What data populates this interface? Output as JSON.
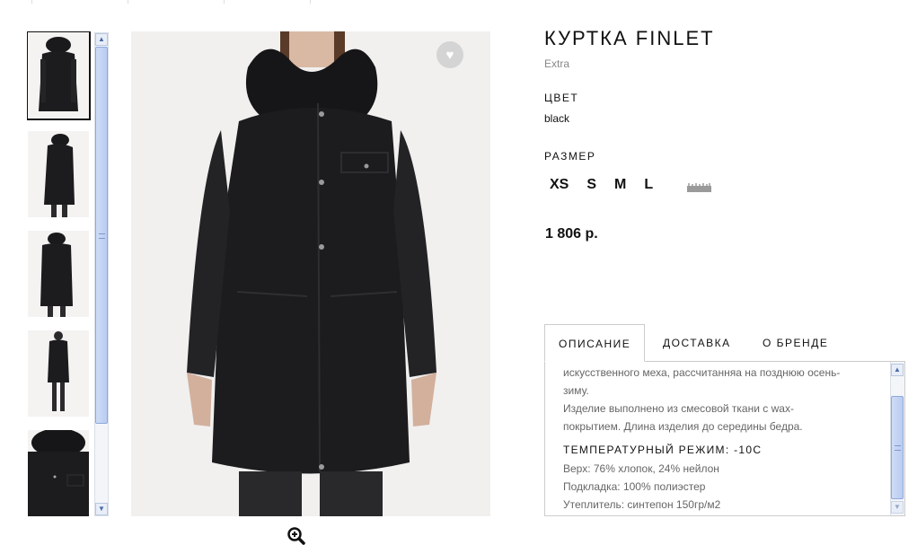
{
  "product": {
    "title": "КУРТКА FINLET",
    "brand": "Extra",
    "color_label": "ЦВЕТ",
    "color_value": "black",
    "size_label": "РАЗМЕР",
    "sizes": [
      "XS",
      "S",
      "M",
      "L"
    ],
    "price": "1 806 р."
  },
  "tabs": [
    {
      "label": "ОПИСАНИЕ",
      "active": true
    },
    {
      "label": "ДОСТАВКА",
      "active": false
    },
    {
      "label": "О БРЕНДЕ",
      "active": false
    }
  ],
  "description": {
    "lines": [
      "искусственного меха, рассчитанняа на позднюю осень-",
      "зиму.",
      "Изделие выполнено из смесовой ткани с wax-",
      "покрытием. Длина изделия до середины бедра."
    ],
    "temperature_heading": "ТЕМПЕРАТУРНЫЙ РЕЖИМ: -10С",
    "specs": [
      "Верх: 76% хлопок, 24% нейлон",
      "Подкладка: 100% полиэстер",
      "Утеплитель: синтепон 150гр/м2"
    ]
  },
  "icons": {
    "favorite": "heart-icon",
    "zoom": "zoom-in-icon",
    "size_chart": "ruler-icon"
  },
  "colors": {
    "jacket": "#1c1b1d",
    "photo_background": "#f1f0ef",
    "scrollbar": "#b9ccf1"
  }
}
